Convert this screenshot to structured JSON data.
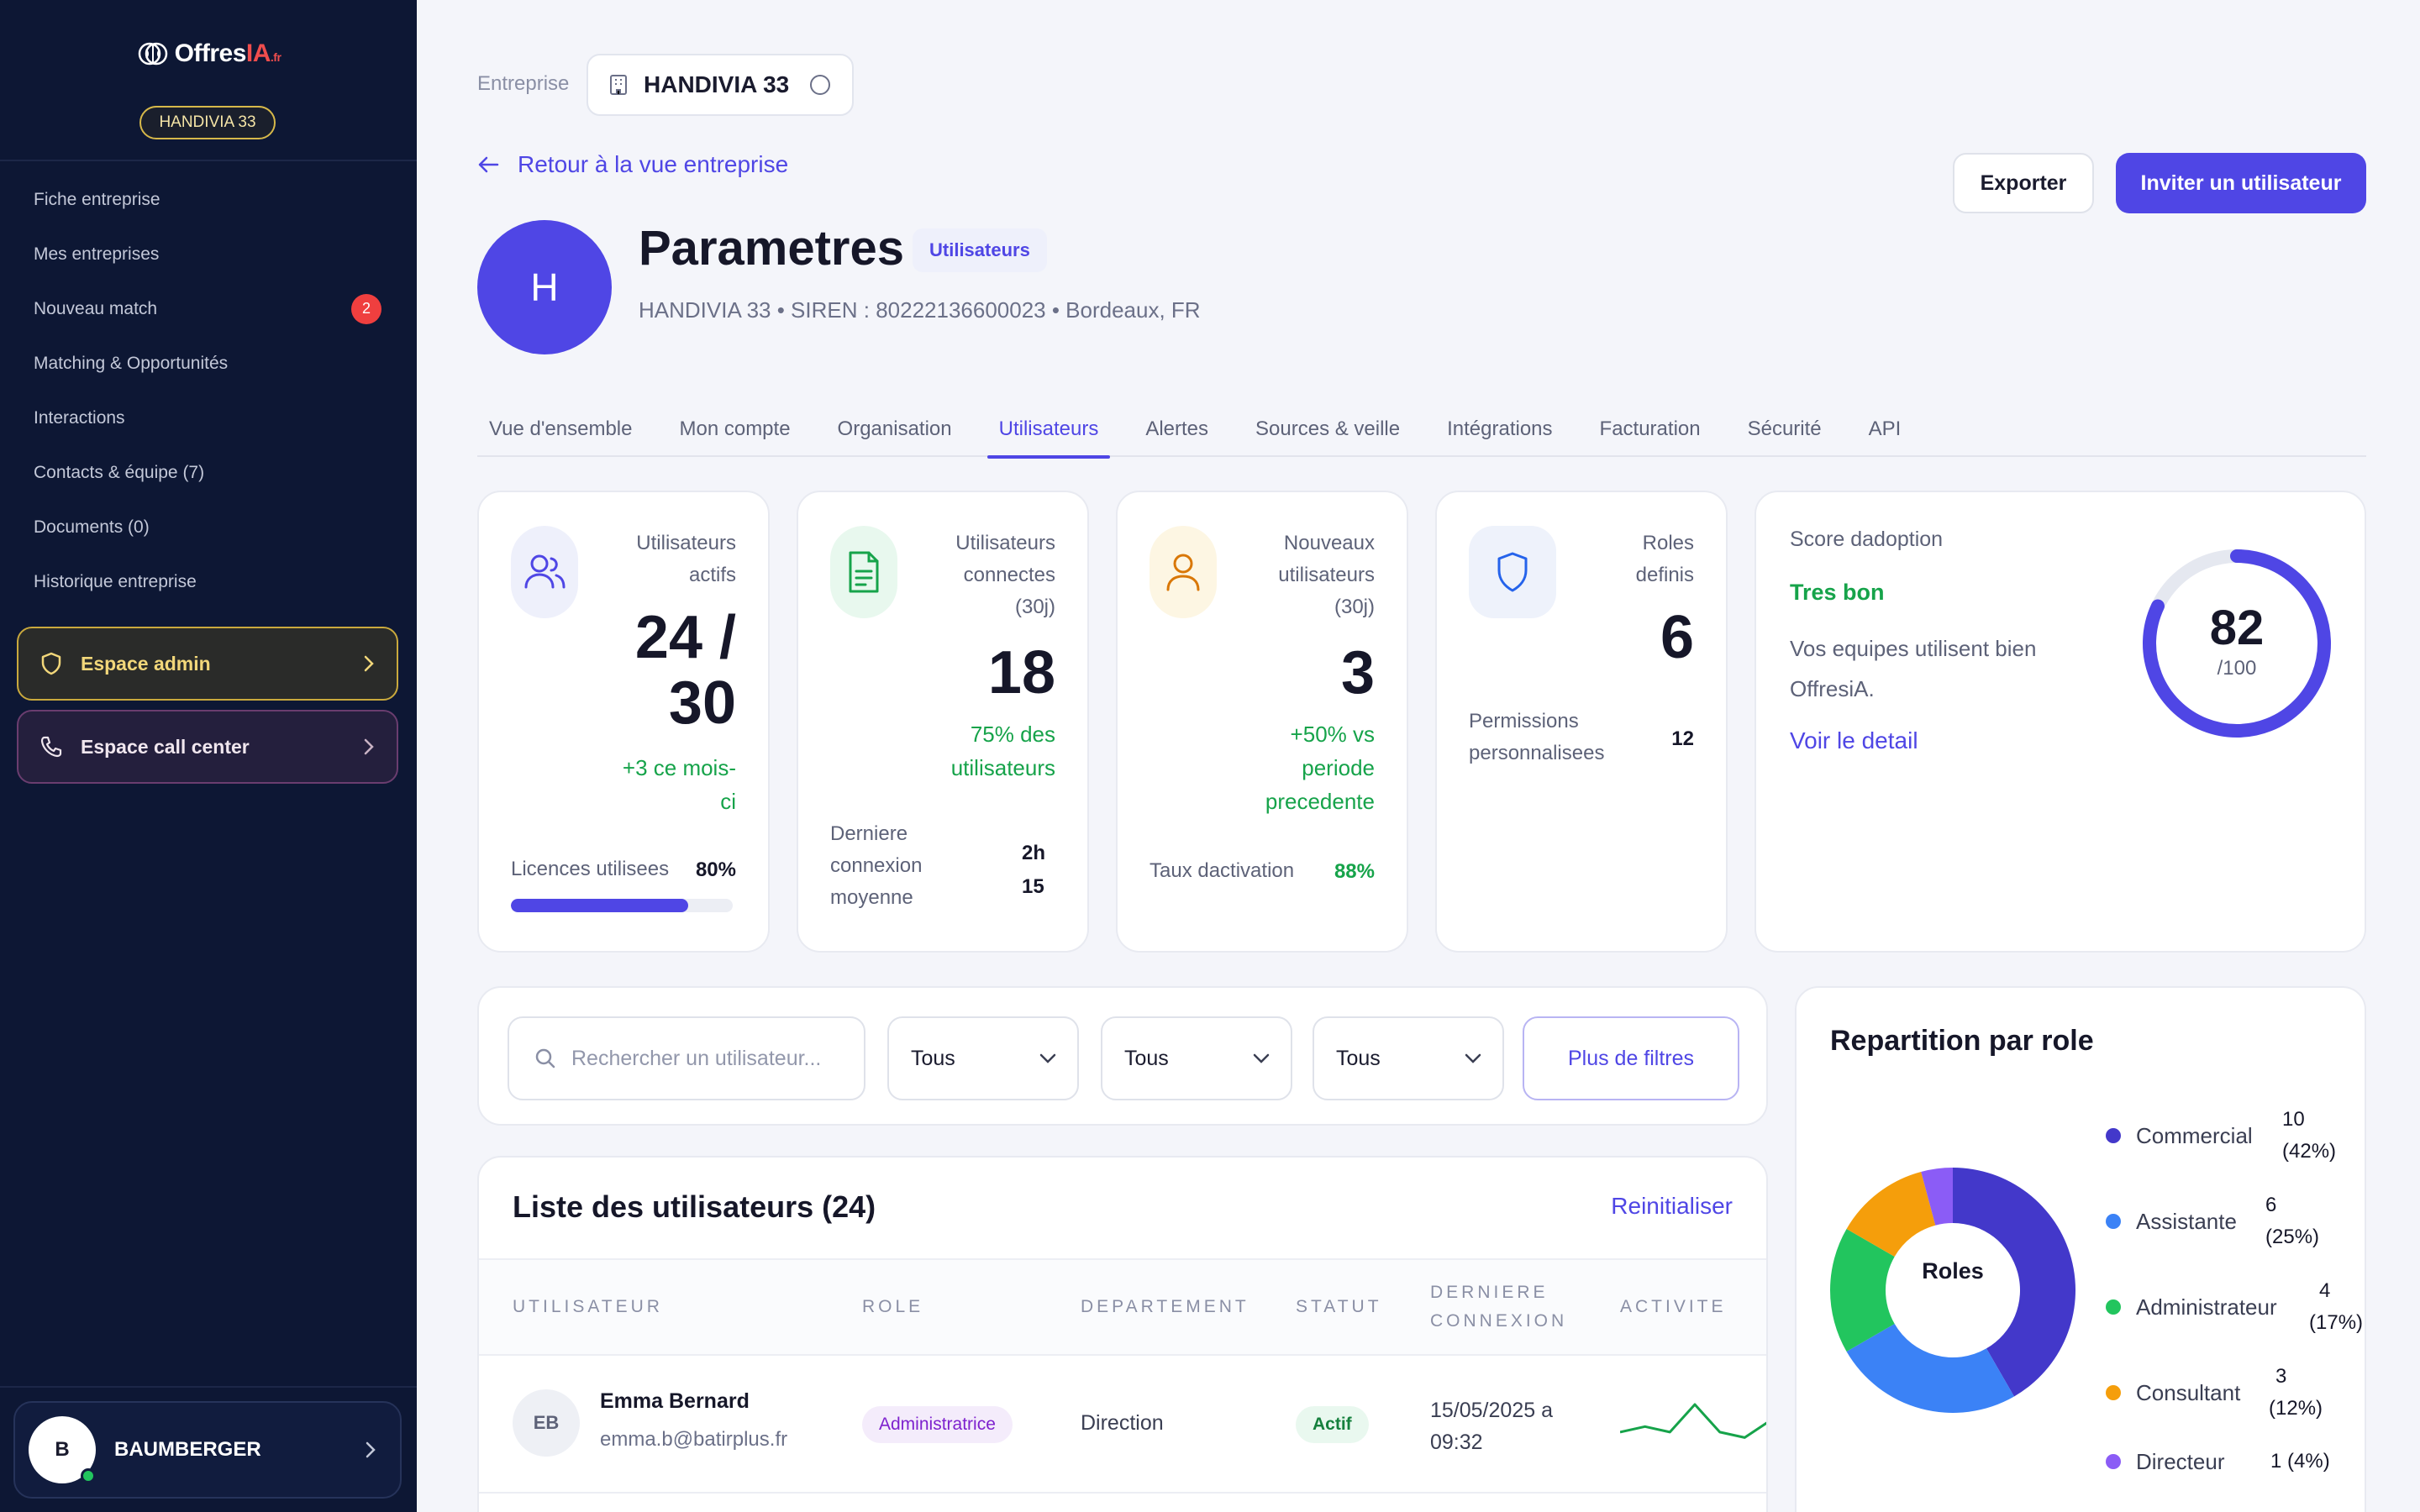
{
  "sidebar": {
    "logo": {
      "main": "Offres",
      "accent": "IA",
      "suffix": ".fr"
    },
    "company_pill": "HANDIVIA 33",
    "items": [
      {
        "label": "Fiche entreprise"
      },
      {
        "label": "Mes entreprises"
      },
      {
        "label": "Nouveau match",
        "badge": "2"
      },
      {
        "label": "Matching & Opportunités"
      },
      {
        "label": "Interactions"
      },
      {
        "label": "Contacts & équipe (7)"
      },
      {
        "label": "Documents (0)"
      },
      {
        "label": "Historique entreprise"
      }
    ],
    "admin_button": "Espace admin",
    "callcenter_button": "Espace call center",
    "user": {
      "initial": "B",
      "name": "BAUMBERGER"
    }
  },
  "header": {
    "company_label": "Entreprise",
    "company_name": "HANDIVIA 33",
    "back_link": "Retour à la vue entreprise",
    "export_label": "Exporter",
    "invite_label": "Inviter un utilisateur",
    "avatar_initial": "H",
    "title": "Parametres",
    "title_badge": "Utilisateurs",
    "subtitle": "HANDIVIA 33 • SIREN : 80222136600023 • Bordeaux, FR"
  },
  "tabs": [
    {
      "label": "Vue d'ensemble"
    },
    {
      "label": "Mon compte"
    },
    {
      "label": "Organisation"
    },
    {
      "label": "Utilisateurs",
      "active": true
    },
    {
      "label": "Alertes"
    },
    {
      "label": "Sources & veille"
    },
    {
      "label": "Intégrations"
    },
    {
      "label": "Facturation"
    },
    {
      "label": "Sécurité"
    },
    {
      "label": "API"
    }
  ],
  "stats": {
    "active_users": {
      "label_1": "Utilisateurs",
      "label_2": "actifs",
      "value_1": "24 /",
      "value_2": "30",
      "delta_1": "+3 ce mois-",
      "delta_2": "ci",
      "foot_label": "Licences utilisees",
      "foot_value": "80%",
      "progress": 0.8
    },
    "connected_users": {
      "label_1": "Utilisateurs",
      "label_2": "connectes",
      "label_3": "(30j)",
      "value": "18",
      "delta_1": "75% des",
      "delta_2": "utilisateurs",
      "foot_label_1": "Derniere",
      "foot_label_2": "connexion",
      "foot_label_3": "moyenne",
      "foot_value_1": "2h",
      "foot_value_2": "15"
    },
    "new_users": {
      "label_1": "Nouveaux",
      "label_2": "utilisateurs",
      "label_3": "(30j)",
      "value": "3",
      "delta_1": "+50% vs",
      "delta_2": "periode",
      "delta_3": "precedente",
      "foot_label": "Taux dactivation",
      "foot_value": "88%"
    },
    "roles": {
      "label_1": "Roles",
      "label_2": "definis",
      "value": "6",
      "foot_label_1": "Permissions",
      "foot_label_2": "personnalisees",
      "foot_value": "12"
    }
  },
  "score": {
    "label": "Score dadoption",
    "level": "Tres bon",
    "desc_1": "Vos equipes utilisent bien",
    "desc_2": "OffresiA.",
    "link": "Voir le detail",
    "value": "82",
    "max": "/100",
    "accent": "#4f46e5"
  },
  "filters": {
    "search_placeholder": "Rechercher un utilisateur...",
    "select_1": "Tous",
    "select_2": "Tous",
    "select_3": "Tous",
    "more_label": "Plus de filtres"
  },
  "table": {
    "title": "Liste des utilisateurs (24)",
    "reset_label": "Reinitialiser",
    "columns": {
      "user": "UTILISATEUR",
      "role": "ROLE",
      "department": "DEPARTEMENT",
      "status": "STATUT",
      "last_1": "DERNIERE",
      "last_2": "CONNEXION",
      "activity": "ACTIVITE"
    },
    "rows": [
      {
        "initials": "EB",
        "name": "Emma Bernard",
        "email": "emma.b@batirplus.fr",
        "role": "Administratrice",
        "department": "Direction",
        "status": "Actif",
        "last_1": "15/05/2025 a",
        "last_2": "09:32",
        "activity": [
          2,
          3,
          2,
          7,
          2,
          1,
          4
        ]
      }
    ]
  },
  "roles_chart": {
    "title": "Repartition par role",
    "center": "Roles",
    "entries": [
      {
        "name": "Commercial",
        "count": 10,
        "val_1": "10",
        "val_2": "(42%)",
        "color": "#4338ca"
      },
      {
        "name": "Assistante",
        "count": 6,
        "val_1": "6",
        "val_2": "(25%)",
        "color": "#3b82f6"
      },
      {
        "name": "Administrateur",
        "count": 4,
        "val_1": "4",
        "val_2": "(17%)",
        "color": "#22c55e"
      },
      {
        "name": "Consultant",
        "count": 3,
        "val_1": "3",
        "val_2": "(12%)",
        "color": "#f59e0b"
      },
      {
        "name": "Directeur",
        "count": 1,
        "val_1": "1 (4%)",
        "val_2": "",
        "color": "#8b5cf6"
      }
    ]
  }
}
